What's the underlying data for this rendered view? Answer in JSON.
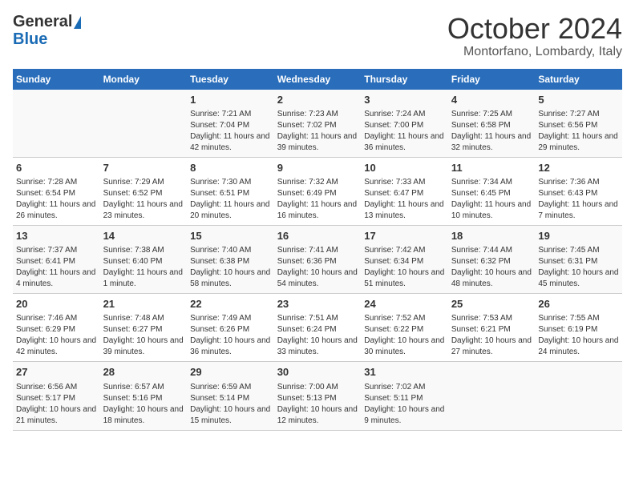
{
  "header": {
    "logo_line1": "General",
    "logo_line2": "Blue",
    "title": "October 2024",
    "subtitle": "Montorfano, Lombardy, Italy"
  },
  "weekdays": [
    "Sunday",
    "Monday",
    "Tuesday",
    "Wednesday",
    "Thursday",
    "Friday",
    "Saturday"
  ],
  "weeks": [
    [
      {
        "day": "",
        "sunrise": "",
        "sunset": "",
        "daylight": ""
      },
      {
        "day": "",
        "sunrise": "",
        "sunset": "",
        "daylight": ""
      },
      {
        "day": "1",
        "sunrise": "Sunrise: 7:21 AM",
        "sunset": "Sunset: 7:04 PM",
        "daylight": "Daylight: 11 hours and 42 minutes."
      },
      {
        "day": "2",
        "sunrise": "Sunrise: 7:23 AM",
        "sunset": "Sunset: 7:02 PM",
        "daylight": "Daylight: 11 hours and 39 minutes."
      },
      {
        "day": "3",
        "sunrise": "Sunrise: 7:24 AM",
        "sunset": "Sunset: 7:00 PM",
        "daylight": "Daylight: 11 hours and 36 minutes."
      },
      {
        "day": "4",
        "sunrise": "Sunrise: 7:25 AM",
        "sunset": "Sunset: 6:58 PM",
        "daylight": "Daylight: 11 hours and 32 minutes."
      },
      {
        "day": "5",
        "sunrise": "Sunrise: 7:27 AM",
        "sunset": "Sunset: 6:56 PM",
        "daylight": "Daylight: 11 hours and 29 minutes."
      }
    ],
    [
      {
        "day": "6",
        "sunrise": "Sunrise: 7:28 AM",
        "sunset": "Sunset: 6:54 PM",
        "daylight": "Daylight: 11 hours and 26 minutes."
      },
      {
        "day": "7",
        "sunrise": "Sunrise: 7:29 AM",
        "sunset": "Sunset: 6:52 PM",
        "daylight": "Daylight: 11 hours and 23 minutes."
      },
      {
        "day": "8",
        "sunrise": "Sunrise: 7:30 AM",
        "sunset": "Sunset: 6:51 PM",
        "daylight": "Daylight: 11 hours and 20 minutes."
      },
      {
        "day": "9",
        "sunrise": "Sunrise: 7:32 AM",
        "sunset": "Sunset: 6:49 PM",
        "daylight": "Daylight: 11 hours and 16 minutes."
      },
      {
        "day": "10",
        "sunrise": "Sunrise: 7:33 AM",
        "sunset": "Sunset: 6:47 PM",
        "daylight": "Daylight: 11 hours and 13 minutes."
      },
      {
        "day": "11",
        "sunrise": "Sunrise: 7:34 AM",
        "sunset": "Sunset: 6:45 PM",
        "daylight": "Daylight: 11 hours and 10 minutes."
      },
      {
        "day": "12",
        "sunrise": "Sunrise: 7:36 AM",
        "sunset": "Sunset: 6:43 PM",
        "daylight": "Daylight: 11 hours and 7 minutes."
      }
    ],
    [
      {
        "day": "13",
        "sunrise": "Sunrise: 7:37 AM",
        "sunset": "Sunset: 6:41 PM",
        "daylight": "Daylight: 11 hours and 4 minutes."
      },
      {
        "day": "14",
        "sunrise": "Sunrise: 7:38 AM",
        "sunset": "Sunset: 6:40 PM",
        "daylight": "Daylight: 11 hours and 1 minute."
      },
      {
        "day": "15",
        "sunrise": "Sunrise: 7:40 AM",
        "sunset": "Sunset: 6:38 PM",
        "daylight": "Daylight: 10 hours and 58 minutes."
      },
      {
        "day": "16",
        "sunrise": "Sunrise: 7:41 AM",
        "sunset": "Sunset: 6:36 PM",
        "daylight": "Daylight: 10 hours and 54 minutes."
      },
      {
        "day": "17",
        "sunrise": "Sunrise: 7:42 AM",
        "sunset": "Sunset: 6:34 PM",
        "daylight": "Daylight: 10 hours and 51 minutes."
      },
      {
        "day": "18",
        "sunrise": "Sunrise: 7:44 AM",
        "sunset": "Sunset: 6:32 PM",
        "daylight": "Daylight: 10 hours and 48 minutes."
      },
      {
        "day": "19",
        "sunrise": "Sunrise: 7:45 AM",
        "sunset": "Sunset: 6:31 PM",
        "daylight": "Daylight: 10 hours and 45 minutes."
      }
    ],
    [
      {
        "day": "20",
        "sunrise": "Sunrise: 7:46 AM",
        "sunset": "Sunset: 6:29 PM",
        "daylight": "Daylight: 10 hours and 42 minutes."
      },
      {
        "day": "21",
        "sunrise": "Sunrise: 7:48 AM",
        "sunset": "Sunset: 6:27 PM",
        "daylight": "Daylight: 10 hours and 39 minutes."
      },
      {
        "day": "22",
        "sunrise": "Sunrise: 7:49 AM",
        "sunset": "Sunset: 6:26 PM",
        "daylight": "Daylight: 10 hours and 36 minutes."
      },
      {
        "day": "23",
        "sunrise": "Sunrise: 7:51 AM",
        "sunset": "Sunset: 6:24 PM",
        "daylight": "Daylight: 10 hours and 33 minutes."
      },
      {
        "day": "24",
        "sunrise": "Sunrise: 7:52 AM",
        "sunset": "Sunset: 6:22 PM",
        "daylight": "Daylight: 10 hours and 30 minutes."
      },
      {
        "day": "25",
        "sunrise": "Sunrise: 7:53 AM",
        "sunset": "Sunset: 6:21 PM",
        "daylight": "Daylight: 10 hours and 27 minutes."
      },
      {
        "day": "26",
        "sunrise": "Sunrise: 7:55 AM",
        "sunset": "Sunset: 6:19 PM",
        "daylight": "Daylight: 10 hours and 24 minutes."
      }
    ],
    [
      {
        "day": "27",
        "sunrise": "Sunrise: 6:56 AM",
        "sunset": "Sunset: 5:17 PM",
        "daylight": "Daylight: 10 hours and 21 minutes."
      },
      {
        "day": "28",
        "sunrise": "Sunrise: 6:57 AM",
        "sunset": "Sunset: 5:16 PM",
        "daylight": "Daylight: 10 hours and 18 minutes."
      },
      {
        "day": "29",
        "sunrise": "Sunrise: 6:59 AM",
        "sunset": "Sunset: 5:14 PM",
        "daylight": "Daylight: 10 hours and 15 minutes."
      },
      {
        "day": "30",
        "sunrise": "Sunrise: 7:00 AM",
        "sunset": "Sunset: 5:13 PM",
        "daylight": "Daylight: 10 hours and 12 minutes."
      },
      {
        "day": "31",
        "sunrise": "Sunrise: 7:02 AM",
        "sunset": "Sunset: 5:11 PM",
        "daylight": "Daylight: 10 hours and 9 minutes."
      },
      {
        "day": "",
        "sunrise": "",
        "sunset": "",
        "daylight": ""
      },
      {
        "day": "",
        "sunrise": "",
        "sunset": "",
        "daylight": ""
      }
    ]
  ]
}
